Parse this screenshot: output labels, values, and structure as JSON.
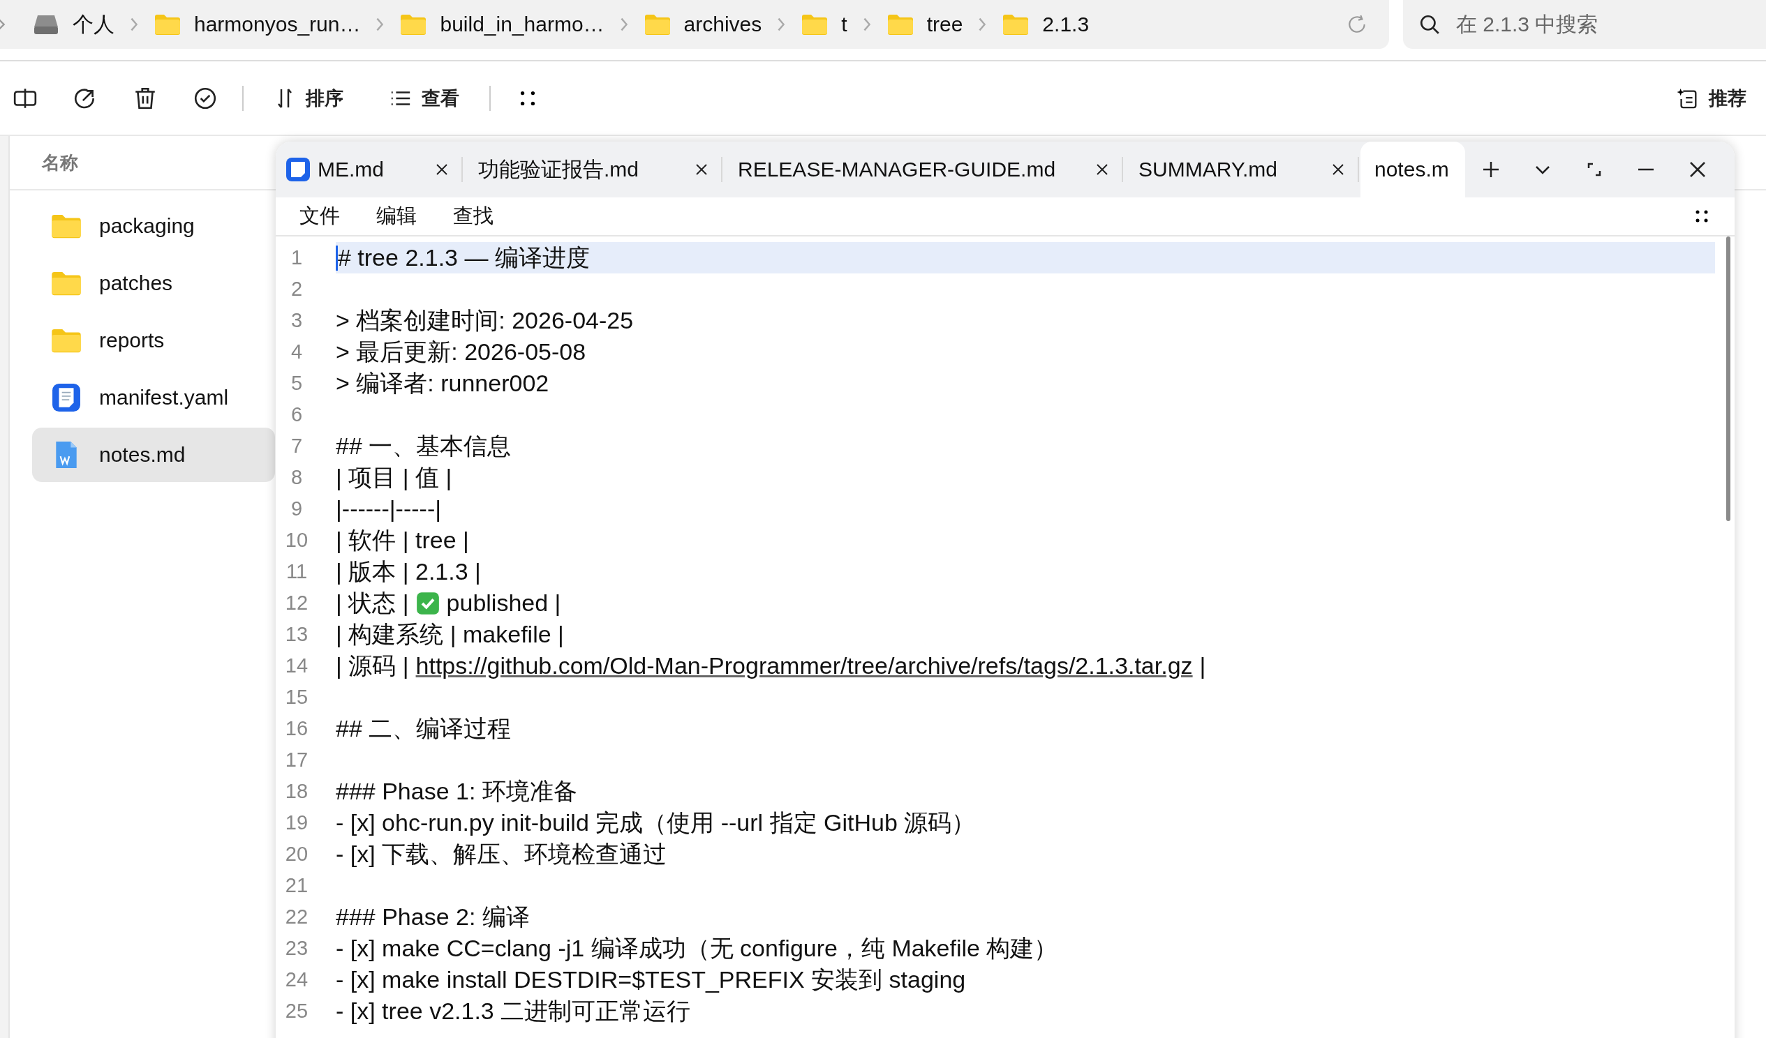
{
  "breadcrumb": [
    {
      "kind": "drive",
      "label": "个人"
    },
    {
      "kind": "folder",
      "label": "harmonyos_run…"
    },
    {
      "kind": "folder",
      "label": "build_in_harmo…"
    },
    {
      "kind": "folder",
      "label": "archives"
    },
    {
      "kind": "folder",
      "label": "t"
    },
    {
      "kind": "folder",
      "label": "tree"
    },
    {
      "kind": "folder",
      "label": "2.1.3"
    }
  ],
  "search": {
    "placeholder": "在 2.1.3 中搜索"
  },
  "toolbar": {
    "sort": "排序",
    "view": "查看",
    "recommend": "推荐"
  },
  "files": {
    "column": "名称",
    "items": [
      {
        "kind": "folder",
        "name": "packaging",
        "selected": false
      },
      {
        "kind": "folder",
        "name": "patches",
        "selected": false
      },
      {
        "kind": "folder",
        "name": "reports",
        "selected": false
      },
      {
        "kind": "doc",
        "name": "manifest.yaml",
        "selected": false
      },
      {
        "kind": "word",
        "name": "notes.md",
        "selected": true
      }
    ]
  },
  "editor": {
    "tabs": [
      {
        "label": "ME.md",
        "icon": true,
        "selected": false
      },
      {
        "label": "功能验证报告.md",
        "icon": false,
        "selected": false
      },
      {
        "label": "RELEASE-MANAGER-GUIDE.md",
        "icon": false,
        "selected": false
      },
      {
        "label": "SUMMARY.md",
        "icon": false,
        "selected": false
      },
      {
        "label": "notes.m",
        "icon": false,
        "selected": true
      }
    ],
    "menu": [
      "文件",
      "编辑",
      "查找"
    ],
    "lines": [
      {
        "num": "1",
        "kind": "plain",
        "text": "# tree 2.1.3 — 编译进度",
        "selected": true
      },
      {
        "num": "2",
        "kind": "plain",
        "selected": false
      },
      {
        "num": "3",
        "kind": "plain",
        "text": "> 档案创建时间: 2026-04-25",
        "selected": false
      },
      {
        "num": "4",
        "kind": "plain",
        "text": "> 最后更新: 2026-05-08",
        "selected": false
      },
      {
        "num": "5",
        "kind": "plain",
        "text": "> 编译者: runner002",
        "selected": false
      },
      {
        "num": "6",
        "kind": "plain",
        "selected": false
      },
      {
        "num": "7",
        "kind": "plain",
        "text": "## 一、基本信息",
        "selected": false
      },
      {
        "num": "8",
        "kind": "plain",
        "text": "| 项目 | 值 |",
        "selected": false
      },
      {
        "num": "9",
        "kind": "plain",
        "text": "|------|-----|",
        "selected": false
      },
      {
        "num": "10",
        "kind": "plain",
        "text": "| 软件 | tree |",
        "selected": false
      },
      {
        "num": "11",
        "kind": "plain",
        "text": "| 版本 | 2.1.3 |",
        "selected": false
      },
      {
        "num": "12",
        "kind": "check",
        "prefix": "| 状态 |",
        "text": "published |",
        "selected": false
      },
      {
        "num": "13",
        "kind": "plain",
        "text": "| 构建系统 | makefile |",
        "selected": false
      },
      {
        "num": "14",
        "kind": "link",
        "prefix": "| 源码 |",
        "link": "https://github.com/Old-Man-Programmer/tree/archive/refs/tags/2.1.3.tar.gz",
        "text": "|",
        "selected": false
      },
      {
        "num": "15",
        "kind": "plain",
        "selected": false
      },
      {
        "num": "16",
        "kind": "plain",
        "text": "## 二、编译过程",
        "selected": false
      },
      {
        "num": "17",
        "kind": "plain",
        "selected": false
      },
      {
        "num": "18",
        "kind": "plain",
        "text": "### Phase 1: 环境准备",
        "selected": false
      },
      {
        "num": "19",
        "kind": "plain",
        "text": "- [x] ohc-run.py init-build 完成（使用 --url 指定 GitHub 源码）",
        "selected": false
      },
      {
        "num": "20",
        "kind": "plain",
        "text": "- [x] 下载、解压、环境检查通过",
        "selected": false
      },
      {
        "num": "21",
        "kind": "plain",
        "selected": false
      },
      {
        "num": "22",
        "kind": "plain",
        "text": "### Phase 2: 编译",
        "selected": false
      },
      {
        "num": "23",
        "kind": "plain",
        "text": "- [x] make CC=clang -j1 编译成功（无 configure，纯 Makefile 构建）",
        "selected": false
      },
      {
        "num": "24",
        "kind": "plain",
        "text": "- [x] make install DESTDIR=$TEST_PREFIX 安装到 staging",
        "selected": false
      },
      {
        "num": "25",
        "kind": "plain",
        "text": "- [x] tree v2.1.3 二进制可正常运行",
        "selected": false
      }
    ]
  }
}
